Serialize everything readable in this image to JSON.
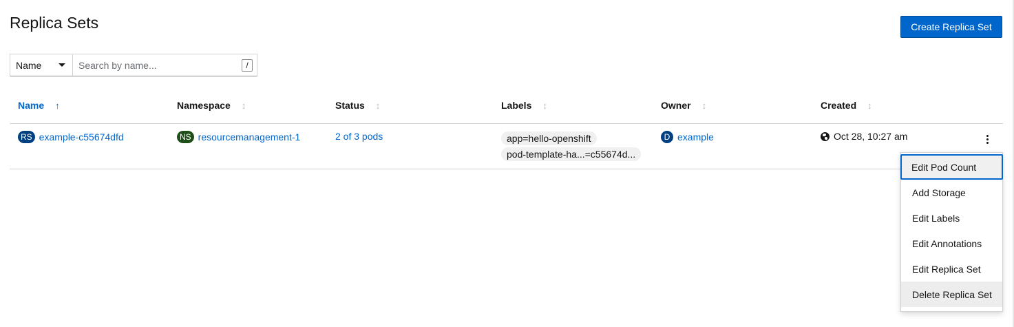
{
  "page": {
    "title": "Replica Sets",
    "create_button": "Create Replica Set"
  },
  "filter": {
    "type": "Name",
    "search_placeholder": "Search by name...",
    "shortcut_key": "/"
  },
  "table": {
    "columns": [
      "Name",
      "Namespace",
      "Status",
      "Labels",
      "Owner",
      "Created"
    ],
    "sort_icons": {
      "sorted": "↑",
      "unsorted": "↕"
    },
    "rows": [
      {
        "name_badge": "RS",
        "name": "example-c55674dfd",
        "namespace_badge": "NS",
        "namespace": "resourcemanagement-1",
        "status": "2 of 3 pods",
        "labels": [
          "app=hello-openshift",
          "pod-template-ha...=c55674d..."
        ],
        "owner_badge": "D",
        "owner": "example",
        "created": "Oct 28, 10:27 am"
      }
    ]
  },
  "actions_menu": {
    "items": [
      "Edit Pod Count",
      "Add Storage",
      "Edit Labels",
      "Edit Annotations",
      "Edit Replica Set",
      "Delete Replica Set"
    ]
  },
  "colors": {
    "primary": "#0066cc",
    "rs_badge": "#004080",
    "ns_badge": "#1e4f18"
  },
  "icons": {
    "kebab": "kebab-icon",
    "globe": "globe-icon",
    "caret": "caret-down-icon"
  }
}
